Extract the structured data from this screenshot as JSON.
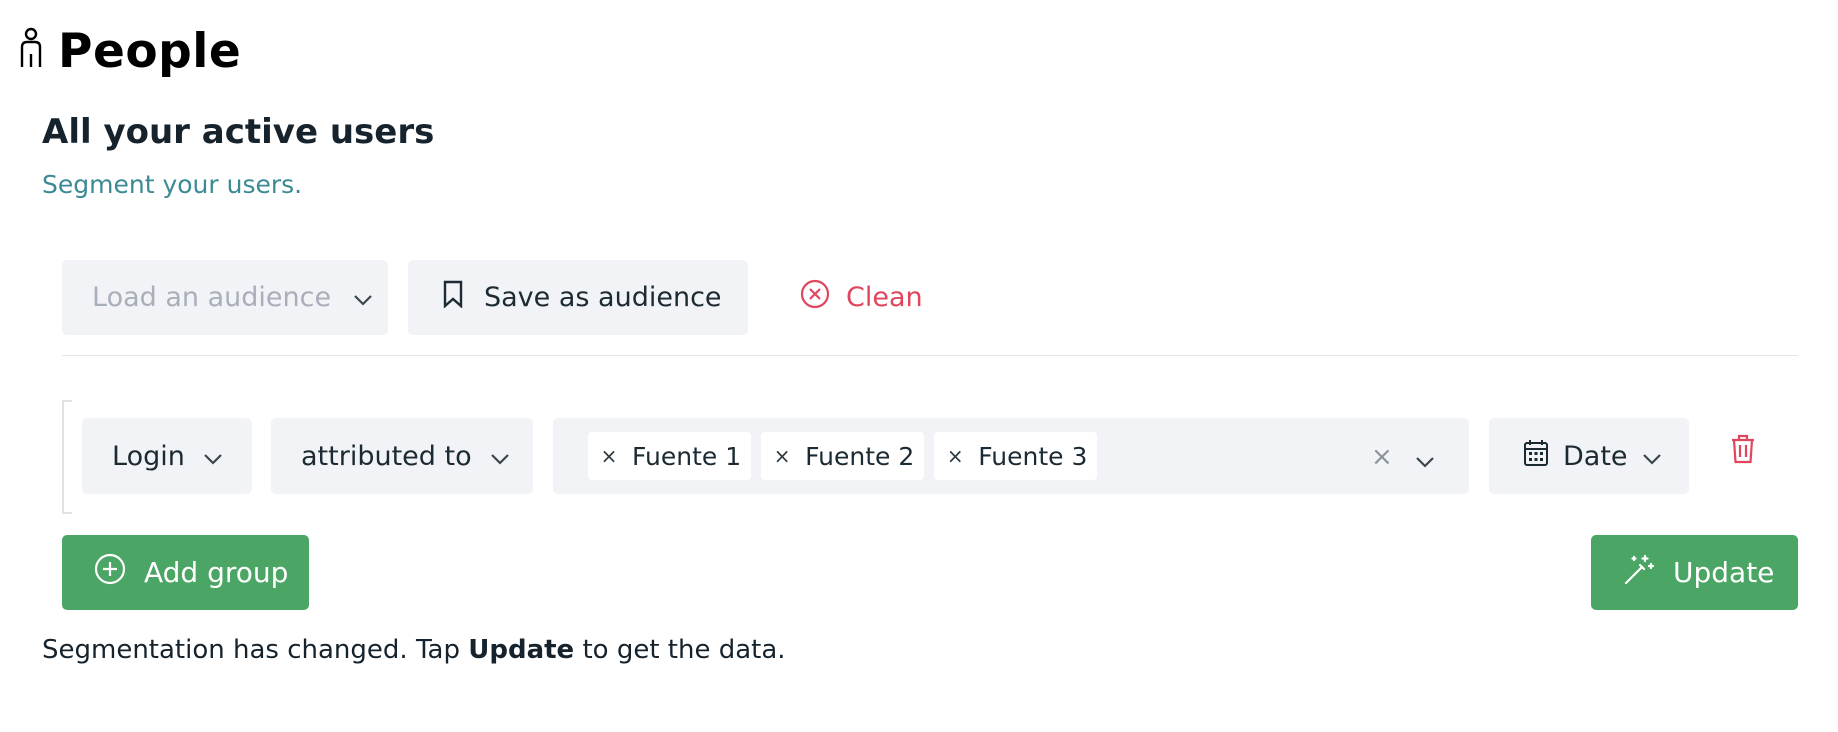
{
  "header": {
    "title": "People",
    "icon": "person-icon"
  },
  "section": {
    "title": "All your active users",
    "subtitle": "Segment your users."
  },
  "toolbar": {
    "load_placeholder": "Load an audience",
    "save_label": "Save as audience",
    "clean_label": "Clean"
  },
  "filter": {
    "event": "Login",
    "relation": "attributed to",
    "chips": [
      "Fuente 1",
      "Fuente 2",
      "Fuente 3"
    ],
    "chip_remove": "×",
    "clear_all": "×",
    "date_label": "Date"
  },
  "actions": {
    "add_group_label": "Add group",
    "update_label": "Update"
  },
  "notice": {
    "before": "Segmentation has changed. Tap ",
    "bold": "Update",
    "after": " to get the data."
  },
  "colors": {
    "accent_green": "#4ba565",
    "danger": "#e0465e",
    "subtitle_teal": "#3b8a94",
    "control_bg": "#f2f3f6"
  }
}
